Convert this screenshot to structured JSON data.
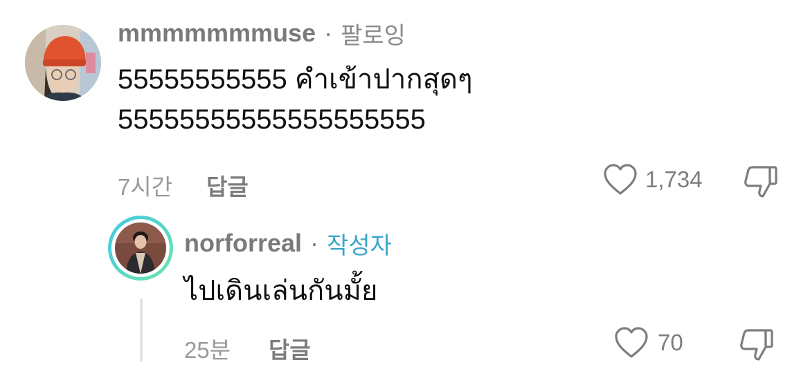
{
  "comment": {
    "username": "mmmmmmmuse",
    "separator": "·",
    "badge": "팔로잉",
    "text_line1": "55555555555 คำเข้าปากสุดๆ",
    "text_line2": "55555555555555555555",
    "time": "7시간",
    "reply_label": "답글",
    "like_count": "1,734",
    "icons": {
      "like": "heart-icon",
      "dislike": "thumbs-down-icon"
    }
  },
  "reply": {
    "username": "norforreal",
    "separator": "·",
    "badge": "작성자",
    "text": "ไปเดินเล่นกันมั้ย",
    "time": "25분",
    "reply_label": "답글",
    "like_count": "70",
    "icons": {
      "like": "heart-icon",
      "dislike": "thumbs-down-icon"
    }
  },
  "colors": {
    "author_badge": "#3aa6c9",
    "story_ring_start": "#43c6e8",
    "story_ring_end": "#6ee7a8"
  }
}
